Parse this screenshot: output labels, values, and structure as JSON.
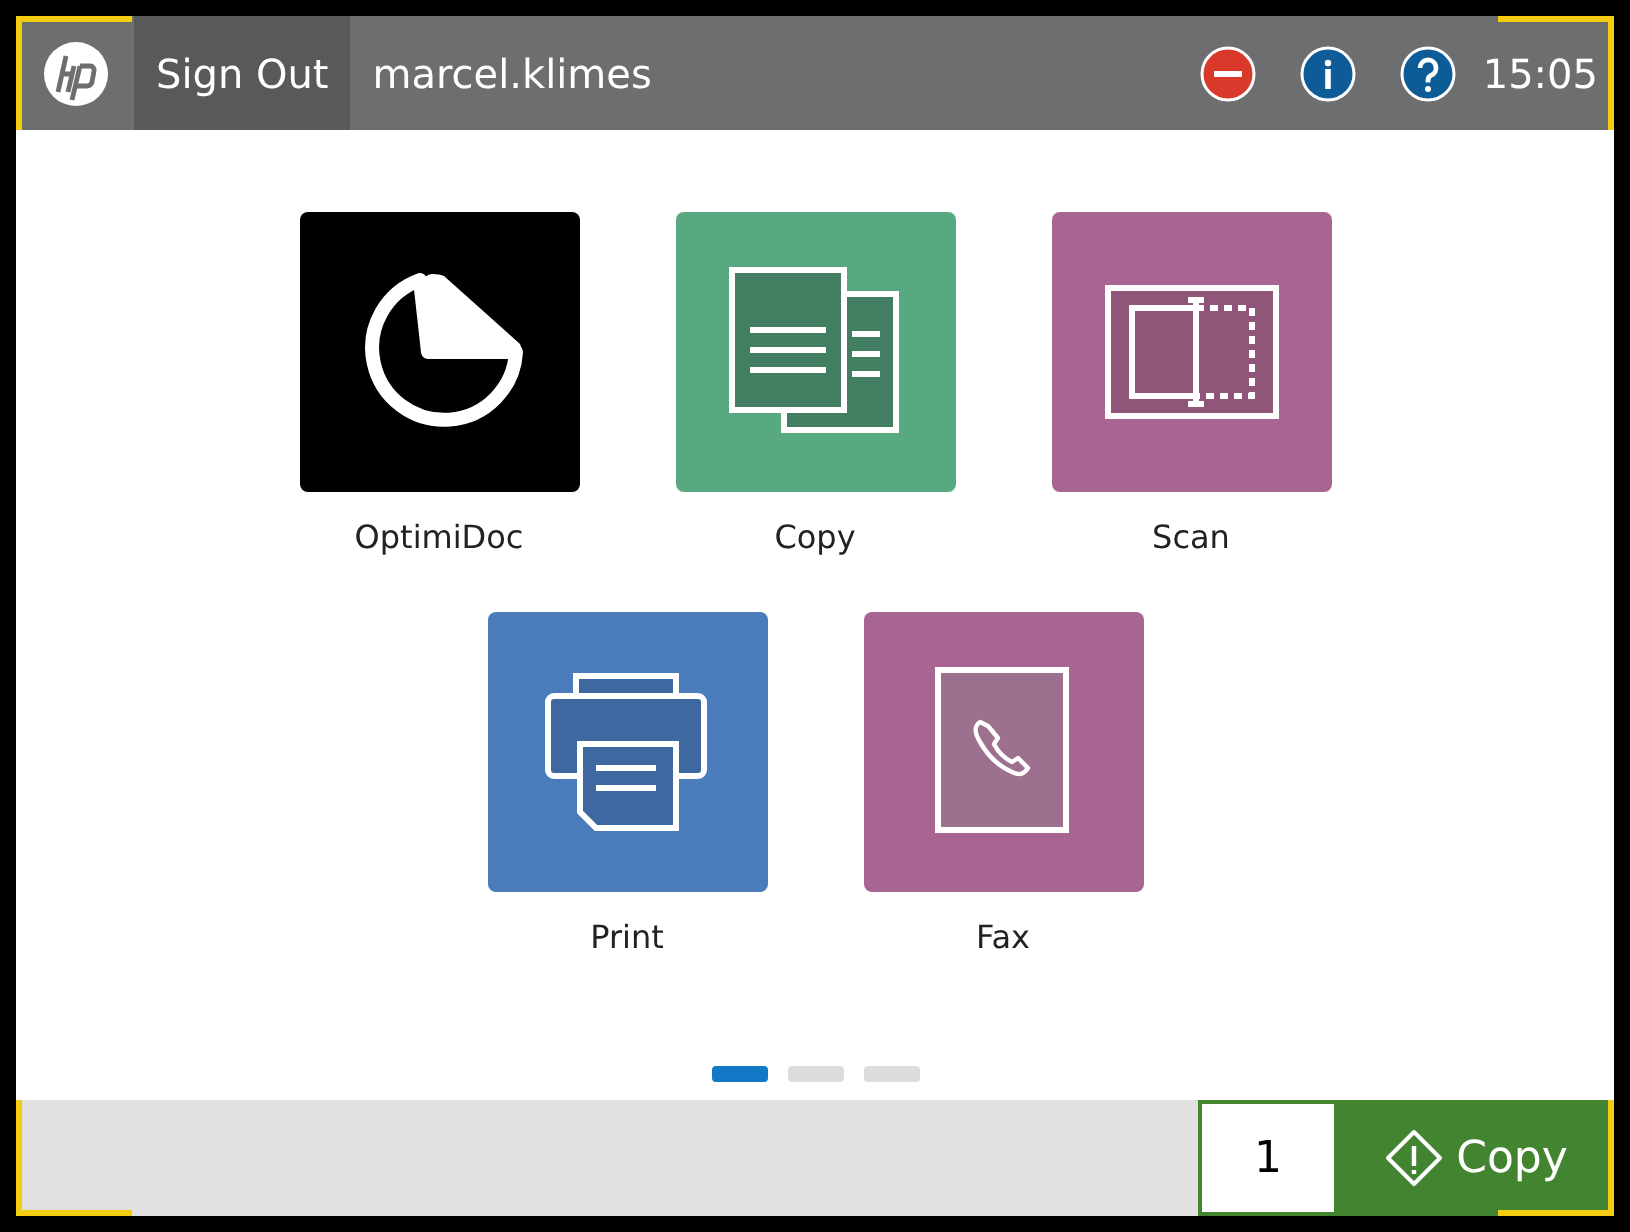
{
  "header": {
    "sign_out": "Sign Out",
    "user": "marcel.klimes",
    "status_icons": [
      {
        "kind": "stop"
      },
      {
        "kind": "info"
      },
      {
        "kind": "help"
      }
    ],
    "time": "15:05"
  },
  "apps": [
    [
      {
        "kind": "optimidoc",
        "label": "OptimiDoc",
        "color": "#000000"
      },
      {
        "kind": "copy",
        "label": "Copy",
        "color": "#58a880"
      },
      {
        "kind": "scan",
        "label": "Scan",
        "color": "#a96592"
      }
    ],
    [
      {
        "kind": "print",
        "label": "Print",
        "color": "#4a7bbb"
      },
      {
        "kind": "fax",
        "label": "Fax",
        "color": "#a96592"
      }
    ]
  ],
  "pages": [
    {
      "selected": true
    },
    {
      "selected": false
    },
    {
      "selected": false
    }
  ],
  "footer": {
    "copies": "1",
    "start_label": "Copy"
  }
}
